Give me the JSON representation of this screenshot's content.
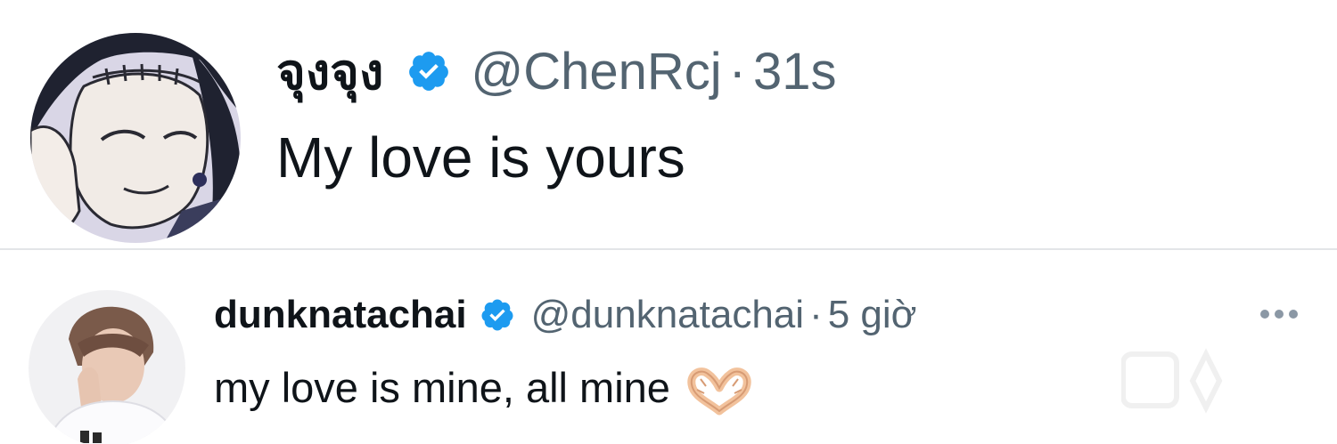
{
  "tweets": [
    {
      "display_name": "จุงจุง",
      "verified": true,
      "handle": "@ChenRcj",
      "separator": "·",
      "time": "31s",
      "text": "My love is yours"
    },
    {
      "display_name": "dunknatachai",
      "verified": true,
      "handle": "@dunknatachai",
      "separator": "·",
      "time": "5 giờ",
      "text": "my love is mine, all mine",
      "emoji": "heart-hands-emoji"
    }
  ],
  "icons": {
    "verified": "verified-badge-icon",
    "more": "more-options-icon"
  },
  "colors": {
    "verified_blue": "#1d9bf0",
    "secondary_text": "#536471",
    "primary_text": "#0f1419",
    "divider": "#e3e5e8"
  }
}
